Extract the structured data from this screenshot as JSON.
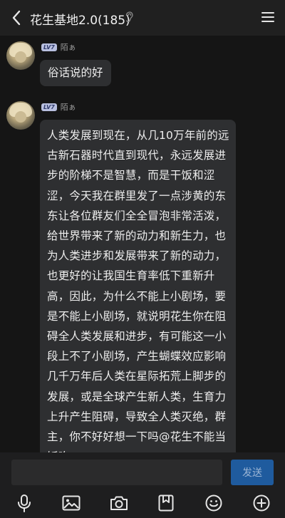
{
  "header": {
    "title": "花生基地2.0(185)",
    "back_icon": "chevron-left-icon",
    "ear_icon": "ear-icon",
    "menu_icon": "hamburger-menu-icon"
  },
  "messages": [
    {
      "level": "LV7",
      "nickname": "陌ぁ",
      "text": "俗话说的好"
    },
    {
      "level": "LV7",
      "nickname": "陌ぁ",
      "text": "人类发展到现在，从几10万年前的远古新石器时代直到现代，永远发展进步的阶梯不是智慧，而是干饭和涩涩，今天我在群里发了一点涉黄的东东让各位群友们全全冒泡非常活泼，给世界带来了新的动力和新生力，也为人类进步和发展带来了新的动力，也更好的让我国生育率低下重新升高，因此，为什么不能上小剧场，要是不能上小剧场，就说明花生你在阻碍全人类发展和进步，有可能这一小段上不了小剧场，产生蝴蝶效应影响几千万年后人类在星际拓荒上脚步的发展，或是全球产生新人类，生育力上升产生阻碍，导致全人类灭绝，群主，你不好好想一下吗@花生不能当饭吃"
    }
  ],
  "composer": {
    "input_value": "",
    "send_label": "发送"
  },
  "toolbar": {
    "icons": [
      "microphone-icon",
      "image-icon",
      "camera-icon",
      "bookmark-box-icon",
      "emoji-icon",
      "plus-icon"
    ]
  }
}
